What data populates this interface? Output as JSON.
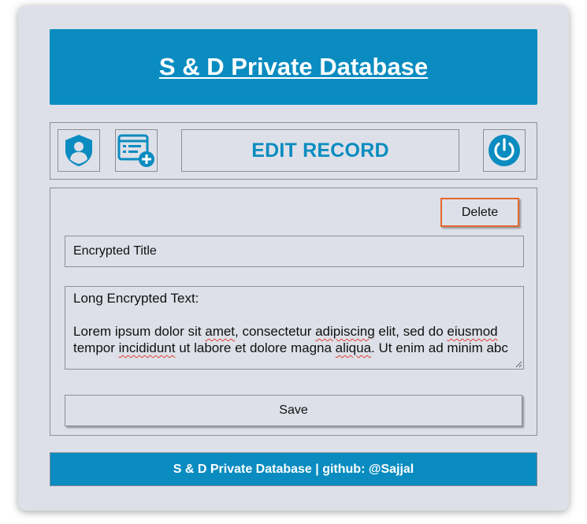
{
  "header": {
    "title": "S & D Private Database"
  },
  "toolbar": {
    "profile_icon": "user-shield-icon",
    "add_icon": "add-record-icon",
    "page_title": "EDIT RECORD",
    "power_icon": "power-icon"
  },
  "record": {
    "delete_label": "Delete",
    "title_value": "Encrypted Title",
    "text_line1": "Long Encrypted Text:",
    "text_line3a": "Lorem ipsum dolor sit ",
    "text_line3b": "amet",
    "text_line3c": ", consectetur ",
    "text_line3d": "adipiscing",
    "text_line3e": " elit, sed do ",
    "text_line3f": "eiusmod",
    "text_line4a": "tempor ",
    "text_line4b": "incididunt",
    "text_line4c": " ut labore et dolore magna ",
    "text_line4d": "aliqua",
    "text_line4e": ". Ut enim ad minim abc",
    "save_label": "Save"
  },
  "footer": {
    "text": "S & D Private Database | github: @Sajjal"
  },
  "colors": {
    "accent": "#0a8cc0",
    "background": "#dde0e8",
    "delete_border": "#e4672d"
  }
}
